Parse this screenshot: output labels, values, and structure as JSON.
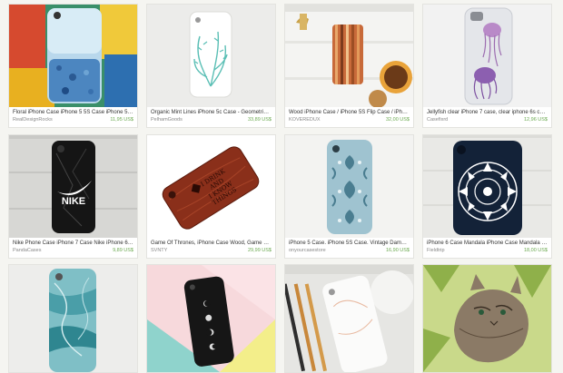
{
  "colors": {
    "price": "#6aa84f",
    "shop": "#888888",
    "title": "#333333",
    "background": "#f5f5f1"
  },
  "listings": [
    {
      "title": "Floral iPhone Case iPhone 5 5S Case iPhone 5C Case...",
      "shop": "RealDesignRocks",
      "price": "11,95 US$"
    },
    {
      "title": "Organic Mint Lines iPhone 5c Case - Geometric iPho...",
      "shop": "PelhamGoods",
      "price": "33,89 US$"
    },
    {
      "title": "Wood iPhone Case / iPhone 5S Flip Case / iPhone 5S...",
      "shop": "KOVEREDUX",
      "price": "32,00 US$"
    },
    {
      "title": "Jellyfish clear iPhone 7 case, clear iphone 6s case,cl...",
      "shop": "Casefixrd",
      "price": "12,96 US$"
    },
    {
      "title": "Nike Phone Case iPhone 7 Case Nike iPhone 6 Case i...",
      "shop": "PandaCases",
      "price": "9,89 US$"
    },
    {
      "title": "Game Of Thrones, iPhone Case Wood, Game of Thro...",
      "shop": "SVNTY",
      "price": "29,99 US$"
    },
    {
      "title": "iPhone 5 Case. iPhone 5S Case. Vintage Damask. Ph...",
      "shop": "onyourcasestore",
      "price": "16,90 US$"
    },
    {
      "title": "iPhone 6 Case Mandala iPhone Case Mandala iPhone...",
      "shop": "Fieldtrip",
      "price": "18,00 US$"
    },
    {
      "title": "",
      "shop": "",
      "price": ""
    },
    {
      "title": "",
      "shop": "",
      "price": ""
    },
    {
      "title": "",
      "shop": "",
      "price": ""
    },
    {
      "title": "",
      "shop": "",
      "price": ""
    }
  ],
  "case_text": {
    "nike_word": "NIKE",
    "wood_line_1": "I DRINK",
    "wood_line_2": "AND",
    "wood_line_3": "I KNOW",
    "wood_line_4": "THINGS"
  }
}
